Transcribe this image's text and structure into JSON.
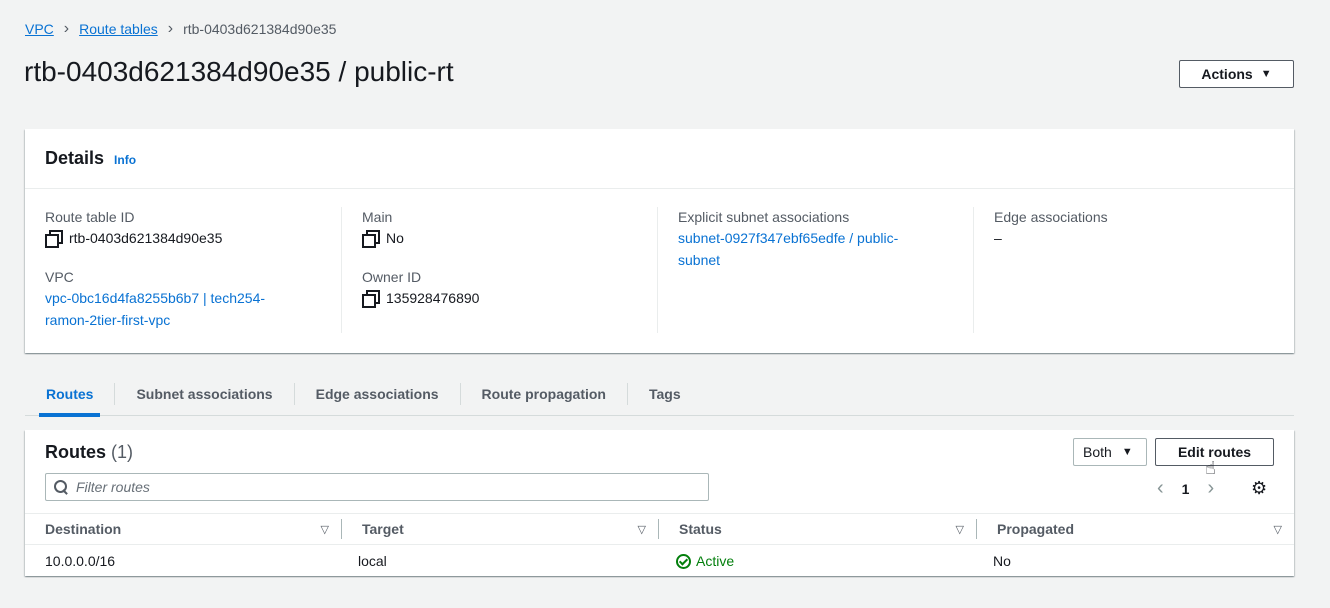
{
  "breadcrumb": {
    "items": [
      "VPC",
      "Route tables"
    ],
    "current": "rtb-0403d621384d90e35"
  },
  "page": {
    "title": "rtb-0403d621384d90e35 / public-rt",
    "actions_label": "Actions"
  },
  "details": {
    "header": "Details",
    "info_label": "Info",
    "route_table_id_label": "Route table ID",
    "route_table_id": "rtb-0403d621384d90e35",
    "vpc_label": "VPC",
    "vpc_value": "vpc-0bc16d4fa8255b6b7 | tech254-ramon-2tier-first-vpc",
    "main_label": "Main",
    "main_value": "No",
    "owner_id_label": "Owner ID",
    "owner_id": "135928476890",
    "explicit_subnet_label": "Explicit subnet associations",
    "explicit_subnet_value": "subnet-0927f347ebf65edfe / public-subnet",
    "edge_label": "Edge associations",
    "edge_value": "–"
  },
  "tabs": [
    {
      "label": "Routes",
      "active": true
    },
    {
      "label": "Subnet associations",
      "active": false
    },
    {
      "label": "Edge associations",
      "active": false
    },
    {
      "label": "Route propagation",
      "active": false
    },
    {
      "label": "Tags",
      "active": false
    }
  ],
  "routes": {
    "title": "Routes",
    "count": "(1)",
    "filter_select": "Both",
    "edit_label": "Edit routes",
    "filter_placeholder": "Filter routes",
    "page_number": "1",
    "columns": [
      "Destination",
      "Target",
      "Status",
      "Propagated"
    ],
    "rows": [
      {
        "destination": "10.0.0.0/16",
        "target": "local",
        "status": "Active",
        "propagated": "No"
      }
    ]
  },
  "colors": {
    "link": "#0972d3",
    "active_status": "#037f0c",
    "background": "#f2f3f3"
  },
  "icons": [
    "chevron-right-icon",
    "caret-down-icon",
    "copy-icon",
    "search-icon",
    "chevron-left-icon",
    "settings-icon",
    "sort-icon",
    "check-circle-icon",
    "pointer-cursor-icon"
  ]
}
